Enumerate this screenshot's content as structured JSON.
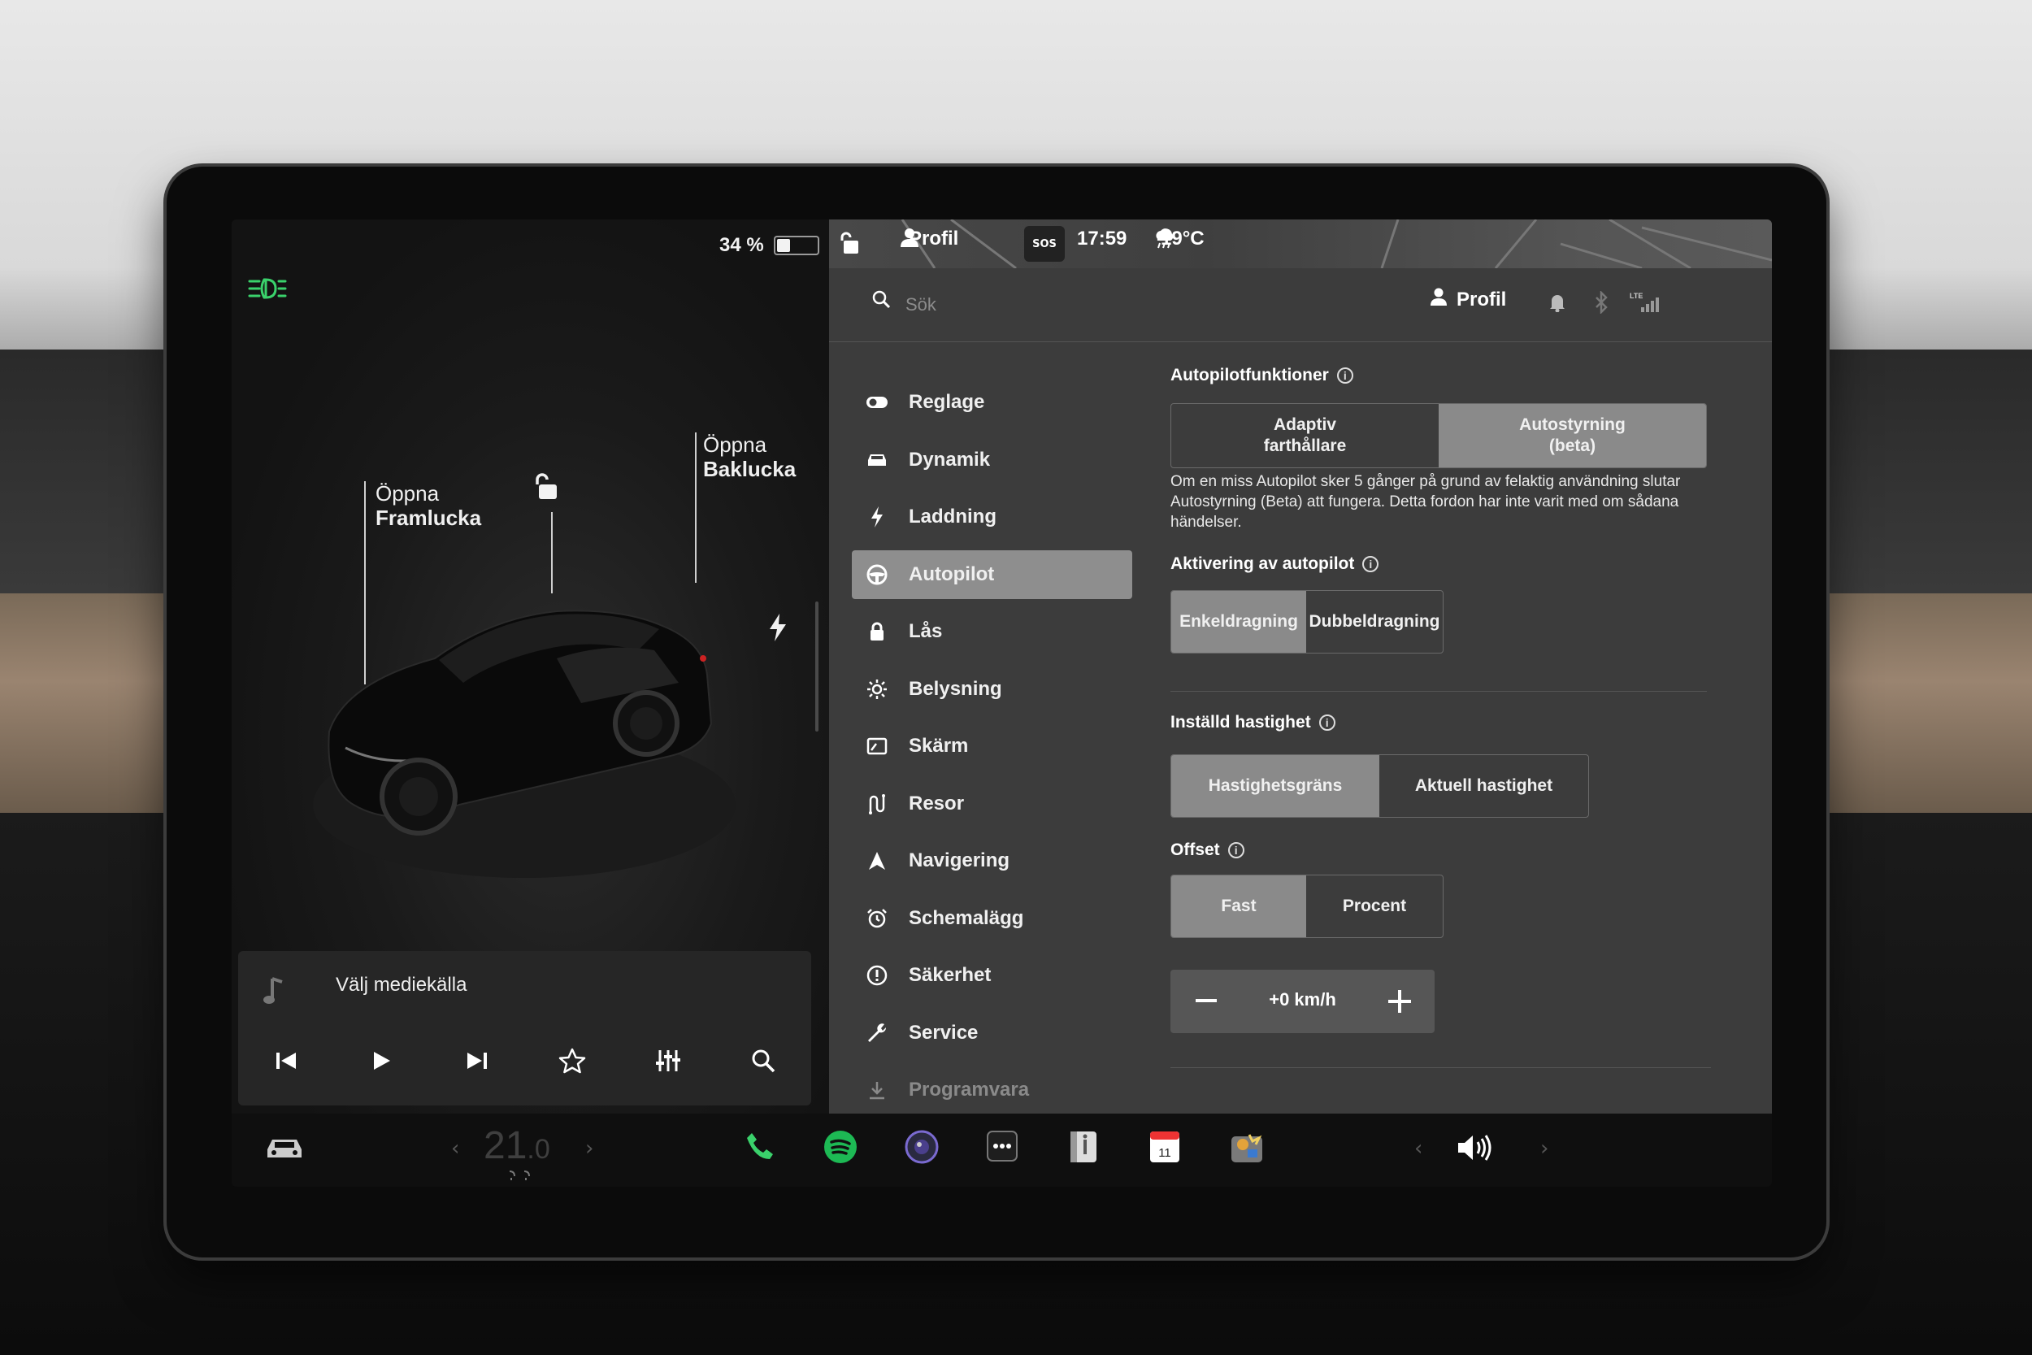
{
  "status_bar": {
    "battery_percent_label": "34 %",
    "battery_level": 0.34,
    "profile_label": "Profil",
    "sos_label": "SOS",
    "time": "17:59",
    "temperature": "19°C"
  },
  "car_panel": {
    "front_trunk_label_line1": "Öppna",
    "front_trunk_label_line2": "Framlucka",
    "rear_trunk_label_line1": "Öppna",
    "rear_trunk_label_line2": "Baklucka"
  },
  "media": {
    "title": "Välj mediekälla",
    "controls": [
      "previous-track-icon",
      "play-icon",
      "next-track-icon",
      "favorite-star-icon",
      "equalizer-icon",
      "search-icon"
    ]
  },
  "settings_header": {
    "search_placeholder": "Sök",
    "profile_label": "Profil",
    "lte_label": "LTE"
  },
  "nav": {
    "items": [
      {
        "label": "Reglage",
        "icon": "toggle-icon"
      },
      {
        "label": "Dynamik",
        "icon": "car-icon"
      },
      {
        "label": "Laddning",
        "icon": "bolt-icon"
      },
      {
        "label": "Autopilot",
        "icon": "steering-wheel-icon",
        "active": true
      },
      {
        "label": "Lås",
        "icon": "lock-icon"
      },
      {
        "label": "Belysning",
        "icon": "sun-icon"
      },
      {
        "label": "Skärm",
        "icon": "display-icon"
      },
      {
        "label": "Resor",
        "icon": "trips-icon"
      },
      {
        "label": "Navigering",
        "icon": "navigation-icon"
      },
      {
        "label": "Schemalägg",
        "icon": "alarm-clock-icon"
      },
      {
        "label": "Säkerhet",
        "icon": "safety-icon"
      },
      {
        "label": "Service",
        "icon": "wrench-icon"
      },
      {
        "label": "Programvara",
        "icon": "download-icon"
      }
    ]
  },
  "autopilot": {
    "features_title": "Autopilotfunktioner",
    "features_options": [
      "Adaptiv\nfarthållare",
      "Autostyrning\n(beta)"
    ],
    "features_selected": 1,
    "features_description": "Om en miss Autopilot sker 5 gånger på grund av felaktig användning slutar Autostyrning (Beta) att fungera. Detta fordon har inte varit med om sådana händelser.",
    "activation_title": "Aktivering av autopilot",
    "activation_options": [
      "Enkeldragning",
      "Dubbeldragning"
    ],
    "activation_selected": 0,
    "speed_title": "Inställd hastighet",
    "speed_options": [
      "Hastighetsgräns",
      "Aktuell hastighet"
    ],
    "speed_selected": 0,
    "offset_title": "Offset",
    "offset_options": [
      "Fast",
      "Procent"
    ],
    "offset_selected": 0,
    "offset_value": "+0 km/h"
  },
  "taskbar": {
    "temperature_whole": "21",
    "temperature_decimal": ".0",
    "calendar_day": "11",
    "apps": [
      "car-icon",
      "phone-icon",
      "spotify-icon",
      "camera-icon",
      "more-icon",
      "manual-icon",
      "calendar-icon",
      "toybox-icon",
      "volume-icon"
    ]
  },
  "colors": {
    "accent_green": "#3ad16b",
    "spotify_green": "#1db954",
    "selected_segment": "#8a8a8a",
    "panel_bg": "#3c3c3c"
  }
}
